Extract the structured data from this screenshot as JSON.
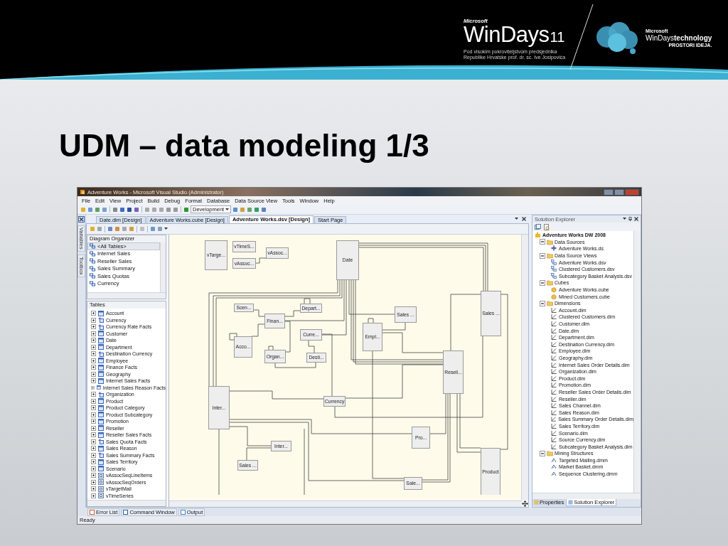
{
  "header": {
    "brand_small": "Microsoft",
    "brand": "WinDays",
    "edition": "11",
    "patronage": [
      "Pod visokim pokroviteljstvom predsjednika",
      "Republike Hrvatske prof. dr. sc. Ive Josipovića"
    ],
    "partner_small": "Microsoft",
    "partner_name": "WinDays",
    "partner_bold": "technology",
    "partner_tagline": "PROSTORI IDEJA."
  },
  "title": "UDM – data modeling 1/3",
  "window": {
    "title": "Adventure Works - Microsoft Visual Studio (Administrator)",
    "menu": [
      "File",
      "Edit",
      "View",
      "Project",
      "Build",
      "Debug",
      "Format",
      "Database",
      "Data Source View",
      "Tools",
      "Window",
      "Help"
    ],
    "toolbar": {
      "configuration": "Development"
    },
    "side_tabs": [
      "Variables",
      "Toolbox"
    ],
    "document_tabs": [
      {
        "label": "Date.dim [Design]",
        "selected": false
      },
      {
        "label": "Adventure Works.cube [Design]",
        "selected": false
      },
      {
        "label": "Adventure Works.dsv [Design]",
        "selected": true
      },
      {
        "label": "Start Page",
        "selected": false
      }
    ],
    "diagram_organizer": {
      "title": "Diagram Organizer",
      "items": [
        {
          "label": "<All Tables>",
          "selected": true
        },
        {
          "label": "Internet Sales",
          "selected": false
        },
        {
          "label": "Reseller Sales",
          "selected": false
        },
        {
          "label": "Sales Summary",
          "selected": false
        },
        {
          "label": "Sales Quotas",
          "selected": false
        },
        {
          "label": "Currency",
          "selected": false
        }
      ]
    },
    "tables": {
      "title": "Tables",
      "items": [
        {
          "label": "Account",
          "kind": "table"
        },
        {
          "label": "Currency",
          "kind": "query"
        },
        {
          "label": "Currency Rate Facts",
          "kind": "query"
        },
        {
          "label": "Customer",
          "kind": "table"
        },
        {
          "label": "Date",
          "kind": "table"
        },
        {
          "label": "Department",
          "kind": "table"
        },
        {
          "label": "Destination Currency",
          "kind": "query"
        },
        {
          "label": "Employee",
          "kind": "table"
        },
        {
          "label": "Finance Facts",
          "kind": "table"
        },
        {
          "label": "Geography",
          "kind": "table"
        },
        {
          "label": "Internet Sales Facts",
          "kind": "table"
        },
        {
          "label": "Internet Sales Reason Facts",
          "kind": "table"
        },
        {
          "label": "Organization",
          "kind": "query"
        },
        {
          "label": "Product",
          "kind": "table"
        },
        {
          "label": "Product Category",
          "kind": "table"
        },
        {
          "label": "Product Subcategory",
          "kind": "table"
        },
        {
          "label": "Promotion",
          "kind": "table"
        },
        {
          "label": "Reseller",
          "kind": "table"
        },
        {
          "label": "Reseller Sales Facts",
          "kind": "table"
        },
        {
          "label": "Sales Quota Facts",
          "kind": "query"
        },
        {
          "label": "Sales Reason",
          "kind": "table"
        },
        {
          "label": "Sales Summary Facts",
          "kind": "query"
        },
        {
          "label": "Sales Territory",
          "kind": "table"
        },
        {
          "label": "Scenario",
          "kind": "table"
        },
        {
          "label": "vAssocSeqLineItems",
          "kind": "view"
        },
        {
          "label": "vAssocSeqOrders",
          "kind": "view"
        },
        {
          "label": "vTargetMail",
          "kind": "view"
        },
        {
          "label": "vTimeSeries",
          "kind": "view"
        }
      ]
    },
    "diagram": {
      "nodes": [
        {
          "label": "vTarge..."
        },
        {
          "label": "vTimeS..."
        },
        {
          "label": "vAssoc..."
        },
        {
          "label": "vAssoc..."
        },
        {
          "label": "Date"
        },
        {
          "label": "Scen..."
        },
        {
          "label": "Depart..."
        },
        {
          "label": "Finan..."
        },
        {
          "label": "Sales ..."
        },
        {
          "label": "Sales ..."
        },
        {
          "label": "Curre..."
        },
        {
          "label": "Acco..."
        },
        {
          "label": "Empl..."
        },
        {
          "label": "Organ..."
        },
        {
          "label": "Desti..."
        },
        {
          "label": "Resell..."
        },
        {
          "label": "Inter..."
        },
        {
          "label": "Currency"
        },
        {
          "label": "Pro..."
        },
        {
          "label": "Inter..."
        },
        {
          "label": "Sales ..."
        },
        {
          "label": "Product"
        },
        {
          "label": "Sale..."
        }
      ]
    },
    "solution_explorer": {
      "title": "Solution Explorer",
      "tree": [
        {
          "label": "Adventure Works DW 2008",
          "kind": "solution",
          "children": [
            {
              "label": "Data Sources",
              "kind": "folder",
              "expanded": true,
              "children": [
                {
                  "label": "Adventure Works.ds",
                  "kind": "datasource"
                }
              ]
            },
            {
              "label": "Data Source Views",
              "kind": "folder",
              "expanded": true,
              "children": [
                {
                  "label": "Adventure Works.dsv",
                  "kind": "dsv"
                },
                {
                  "label": "Clustered Customers.dsv",
                  "kind": "dsv"
                },
                {
                  "label": "Subcategory Basket Analysis.dsv",
                  "kind": "dsv"
                }
              ]
            },
            {
              "label": "Cubes",
              "kind": "folder",
              "expanded": true,
              "children": [
                {
                  "label": "Adventure Works.cube",
                  "kind": "cube"
                },
                {
                  "label": "Mined Customers.cube",
                  "kind": "cube"
                }
              ]
            },
            {
              "label": "Dimensions",
              "kind": "folder",
              "expanded": true,
              "children": [
                {
                  "label": "Account.dim",
                  "kind": "dim"
                },
                {
                  "label": "Clustered Customers.dim",
                  "kind": "dim"
                },
                {
                  "label": "Customer.dim",
                  "kind": "dim"
                },
                {
                  "label": "Date.dim",
                  "kind": "dim"
                },
                {
                  "label": "Department.dim",
                  "kind": "dim"
                },
                {
                  "label": "Destination Currency.dim",
                  "kind": "dim"
                },
                {
                  "label": "Employee.dim",
                  "kind": "dim"
                },
                {
                  "label": "Geography.dim",
                  "kind": "dim"
                },
                {
                  "label": "Internet Sales Order Details.dim",
                  "kind": "dim"
                },
                {
                  "label": "Organization.dim",
                  "kind": "dim"
                },
                {
                  "label": "Product.dim",
                  "kind": "dim"
                },
                {
                  "label": "Promotion.dim",
                  "kind": "dim"
                },
                {
                  "label": "Reseller Sales Order Details.dim",
                  "kind": "dim"
                },
                {
                  "label": "Reseller.dim",
                  "kind": "dim"
                },
                {
                  "label": "Sales Channel.dim",
                  "kind": "dim"
                },
                {
                  "label": "Sales Reason.dim",
                  "kind": "dim"
                },
                {
                  "label": "Sales Summary Order Details.dim",
                  "kind": "dim"
                },
                {
                  "label": "Sales Territory.dim",
                  "kind": "dim"
                },
                {
                  "label": "Scenario.dim",
                  "kind": "dim"
                },
                {
                  "label": "Source Currency.dim",
                  "kind": "dim"
                },
                {
                  "label": "Subcategory Basket Analysis.dim",
                  "kind": "dim"
                }
              ]
            },
            {
              "label": "Mining Structures",
              "kind": "folder",
              "expanded": true,
              "children": [
                {
                  "label": "Targeted Mailing.dmm",
                  "kind": "mining"
                },
                {
                  "label": "Market Basket.dmm",
                  "kind": "mining"
                },
                {
                  "label": "Sequence Clustering.dmm",
                  "kind": "mining"
                }
              ]
            }
          ]
        }
      ],
      "tabs": [
        {
          "label": "Properties",
          "selected": false
        },
        {
          "label": "Solution Explorer",
          "selected": true
        }
      ]
    },
    "bottom_tabs": [
      "Error List",
      "Command Window",
      "Output"
    ],
    "status_bar": "Ready"
  }
}
